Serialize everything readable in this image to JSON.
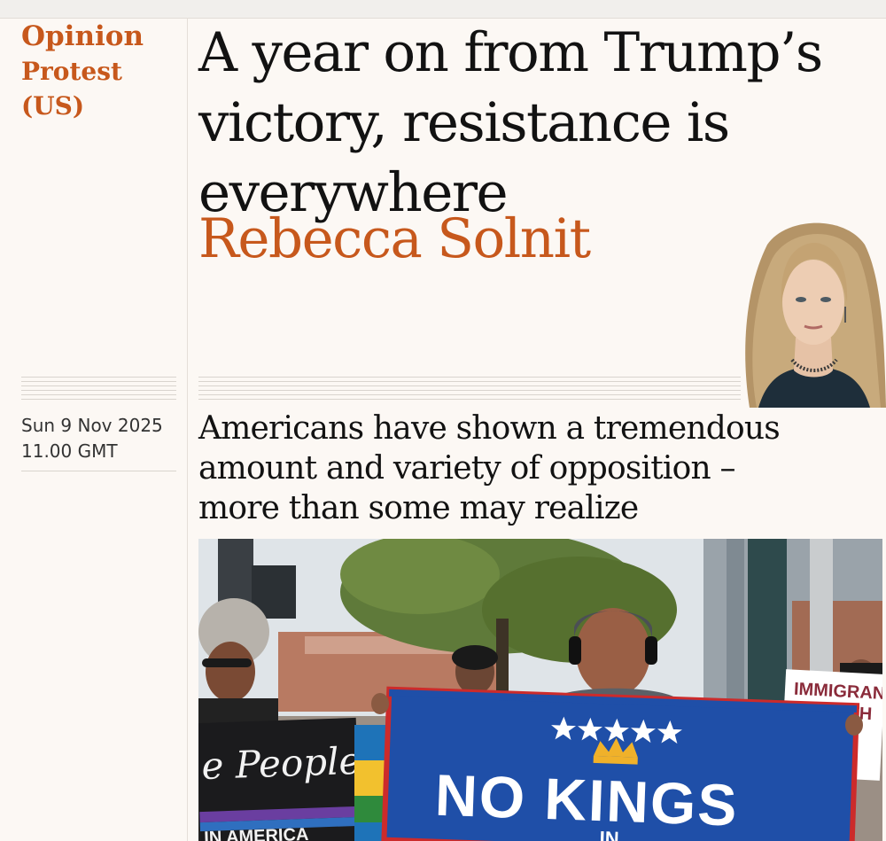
{
  "kicker": {
    "section": "Opinion",
    "series_line1": "Protest",
    "series_line2": "(US)"
  },
  "headline": {
    "line1": "A year on from Trump’s",
    "line2": "victory, resistance is",
    "line3": "everywhere"
  },
  "byline": "Rebecca Solnit",
  "dateline": {
    "date": "Sun 9 Nov 2025",
    "time": "11.00 GMT"
  },
  "standfirst": {
    "line1": "Americans have shown a tremendous",
    "line2": "amount and variety of opposition –",
    "line3": "more than some may realize"
  },
  "photo": {
    "flag_text_main": "NO KINGS",
    "flag_text_sub": "IN",
    "banner_left": "e People",
    "banner_left_bottom": "IN AMERICA",
    "sign_right_line1": "IMMIGRAN",
    "sign_right_line2": "BUILT TH"
  },
  "colors": {
    "accent": "#c7581c",
    "background": "#fcf8f4",
    "text": "#121212",
    "flag_blue": "#1f4fa8",
    "flag_red": "#cc2b2b"
  }
}
